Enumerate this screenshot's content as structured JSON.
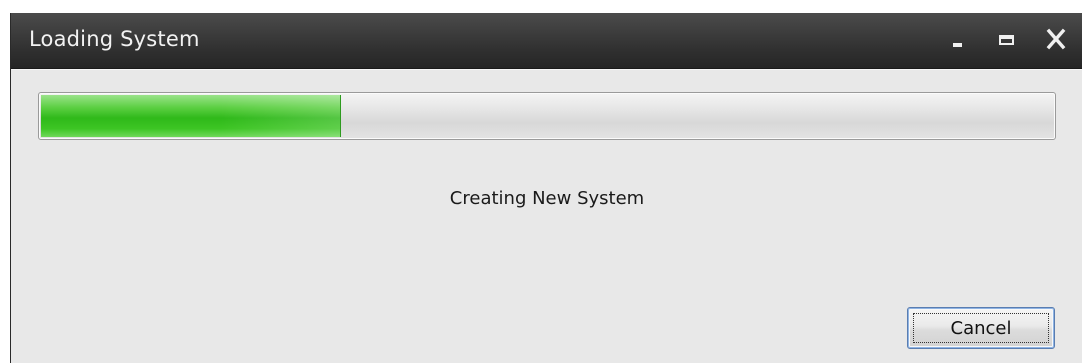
{
  "window": {
    "title": "Loading System",
    "controls": {
      "minimize_icon": "minimize-icon",
      "maximize_icon": "maximize-icon",
      "close_icon": "close-icon"
    }
  },
  "progress": {
    "fraction": 0.295,
    "fill_color": "#3dc524",
    "track_color": "#dcdcdc"
  },
  "status": {
    "text": "Creating New System"
  },
  "buttons": {
    "cancel_label": "Cancel"
  },
  "colors": {
    "titlebar": "#333333",
    "title_text": "#f2f2f2",
    "content_bg": "#e8e8e8",
    "button_focus_border": "#5a7db0"
  }
}
